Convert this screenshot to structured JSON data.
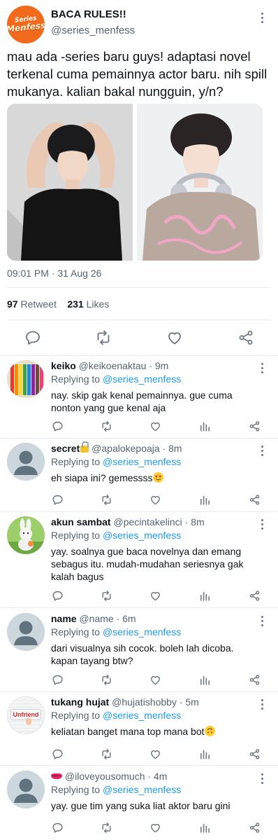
{
  "colors": {
    "link": "#1d9bf0",
    "secondary_text": "#536471",
    "icon": "#6b7580",
    "brand": "#f26a1b"
  },
  "main_tweet": {
    "avatar_logo_line1": "Series",
    "avatar_logo_line2": "Menfess",
    "name": "BACA RULES!!",
    "handle": "@series_menfess",
    "text": "mau ada -series baru guys! adaptasi novel terkenal cuma pemainnya actor baru. nih spill mukanya. kalian bakal nungguin, y/n?",
    "timestamp": "09:01 PM · 31 Aug 26",
    "retweet_count": "97",
    "retweet_label": "Retweet",
    "likes_count": "231",
    "likes_label": "Likes",
    "actions": [
      "reply-icon",
      "retweet-icon",
      "like-icon",
      "share-icon"
    ]
  },
  "replies": [
    {
      "name": "keiko",
      "handle": "@keikoenaktau",
      "time": "· 9m",
      "replying_prefix": "Replying to",
      "mention": "@series_menfess",
      "text": "nay. skip gak kenal pemainnya. gue cuma nonton yang gue kenal aja",
      "avatar": "colored-pencils"
    },
    {
      "name": "secret",
      "handle": "@apalokepoaja",
      "time": "· 8m",
      "replying_prefix": "Replying to",
      "mention": "@series_menfess",
      "text": "eh siapa ini? gemessss",
      "avatar": "default-person"
    },
    {
      "name": "akun sambat",
      "handle": "@pecintakelinci",
      "time": "· 8m",
      "replying_prefix": "Replying to",
      "mention": "@series_menfess",
      "text": "yay. soalnya gue baca novelnya dan emang sebagus itu. mudah-mudahan seriesnya gak kalah bagus",
      "avatar": "rabbit-toy"
    },
    {
      "name": "name",
      "handle": "@name",
      "time": "· 6m",
      "replying_prefix": "Replying to",
      "mention": "@series_menfess",
      "text": "dari visualnya sih cocok. boleh lah dicoba. kapan tayang btw?",
      "avatar": "default-person"
    },
    {
      "name": "tukang hujat",
      "handle": "@hujatishobby",
      "time": "· 5m",
      "replying_prefix": "Replying to",
      "mention": "@series_menfess",
      "text": "keliatan banget mana top mana bot",
      "avatar": "unfriend-button",
      "avatar_text": "Unfriend"
    },
    {
      "name": "",
      "handle": "@iloveyousomuch",
      "time": "· 4m",
      "replying_prefix": "Replying to",
      "mention": "@series_menfess",
      "text": "yay. gue tim yang suka liat aktor baru gini",
      "avatar": "default-person"
    }
  ]
}
